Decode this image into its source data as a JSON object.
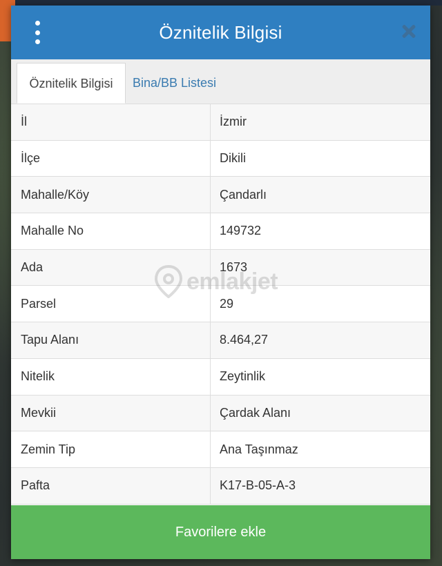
{
  "dialog": {
    "title": "Öznitelik Bilgisi"
  },
  "tabs": [
    {
      "label": "Öznitelik Bilgisi",
      "active": true
    },
    {
      "label": "Bina/BB Listesi",
      "active": false
    }
  ],
  "attributes": [
    {
      "key": "İl",
      "value": "İzmir"
    },
    {
      "key": "İlçe",
      "value": "Dikili"
    },
    {
      "key": "Mahalle/Köy",
      "value": "Çandarlı"
    },
    {
      "key": "Mahalle No",
      "value": "149732"
    },
    {
      "key": "Ada",
      "value": "1673"
    },
    {
      "key": "Parsel",
      "value": "29"
    },
    {
      "key": "Tapu Alanı",
      "value": "8.464,27"
    },
    {
      "key": "Nitelik",
      "value": "Zeytinlik"
    },
    {
      "key": "Mevkii",
      "value": "Çardak Alanı"
    },
    {
      "key": "Zemin Tip",
      "value": "Ana Taşınmaz"
    },
    {
      "key": "Pafta",
      "value": "K17-B-05-A-3"
    }
  ],
  "watermark": {
    "text": "emlakjet"
  },
  "footer": {
    "favorite_label": "Favorilere ekle"
  },
  "colors": {
    "header": "#2f7fc1",
    "button": "#5cb85c",
    "tab_link": "#3a7bb0"
  },
  "icons": {
    "menu": "kebab-menu-icon",
    "close": "close-icon",
    "watermark": "location-pin-icon"
  }
}
